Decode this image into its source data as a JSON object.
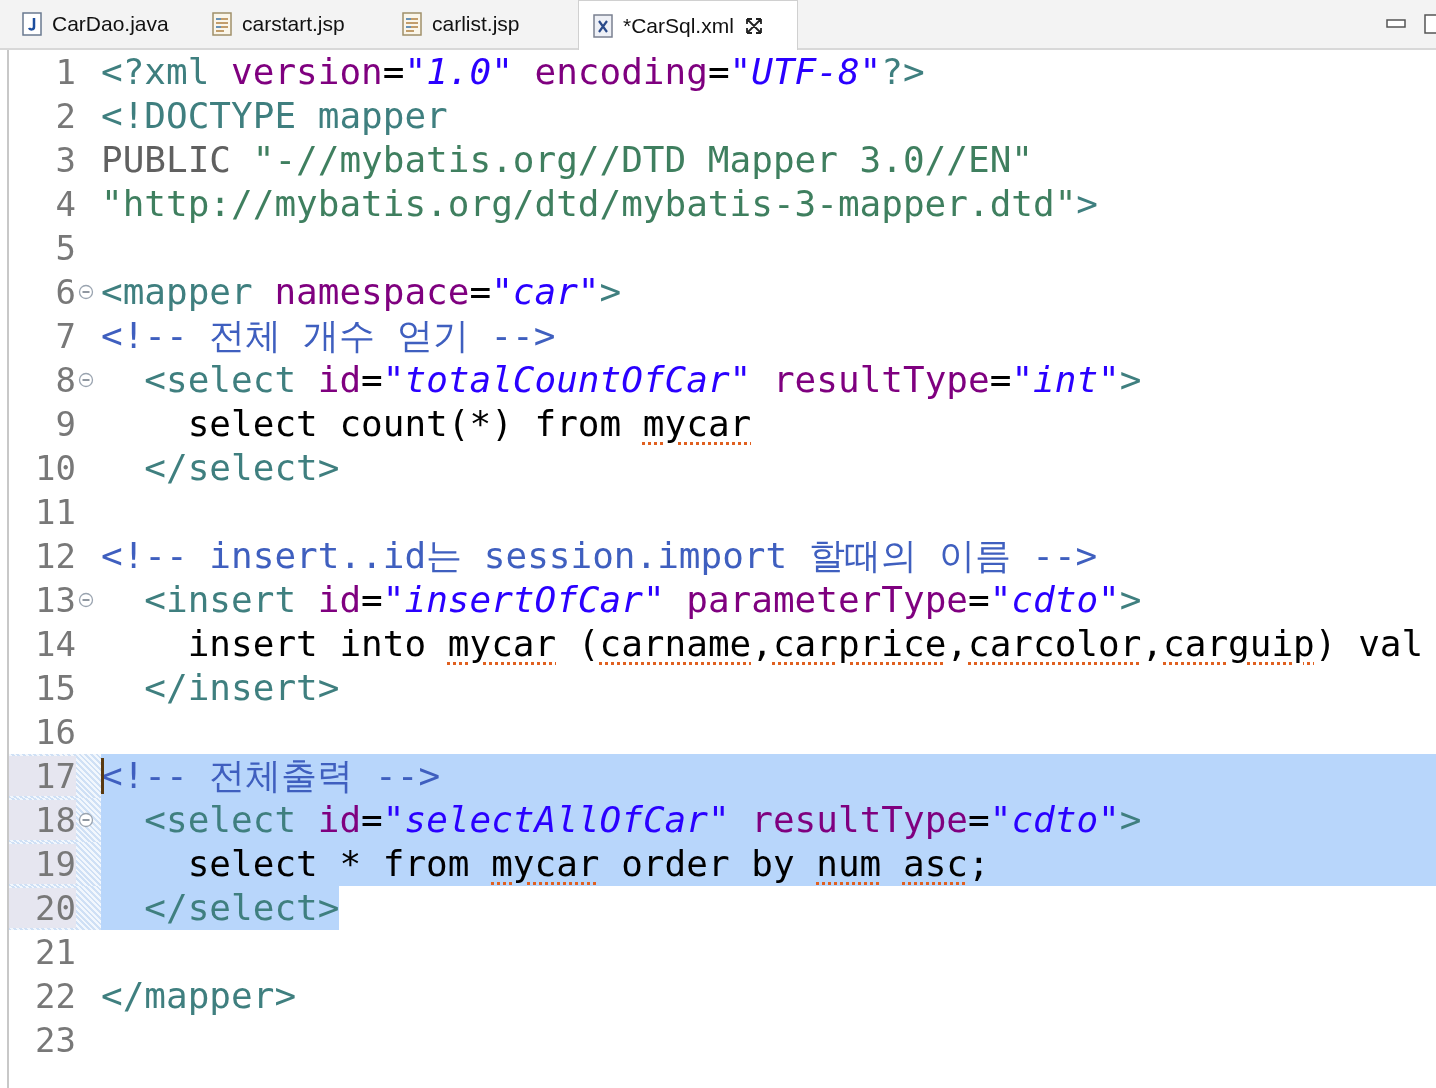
{
  "tabs": [
    {
      "label": "CarDao.java",
      "kind": "java",
      "selected": false
    },
    {
      "label": "carstart.jsp",
      "kind": "jsp",
      "selected": false
    },
    {
      "label": "carlist.jsp",
      "kind": "jsp",
      "selected": false
    },
    {
      "label": "*CarSql.xml",
      "kind": "xml",
      "selected": true
    }
  ],
  "lines": [
    {
      "number": "1",
      "selected": false,
      "tokens": [
        {
          "kind": "tag",
          "text": "<?xml "
        },
        {
          "kind": "attr",
          "text": "version"
        },
        {
          "kind": "text",
          "text": "="
        },
        {
          "kind": "str",
          "text": "\"1.0\" "
        },
        {
          "kind": "attr",
          "text": "encoding"
        },
        {
          "kind": "text",
          "text": "="
        },
        {
          "kind": "str",
          "text": "\"UTF-8\""
        },
        {
          "kind": "tag",
          "text": "?>"
        }
      ]
    },
    {
      "number": "2",
      "selected": false,
      "tokens": [
        {
          "kind": "tag",
          "text": "<!DOCTYPE mapper"
        }
      ]
    },
    {
      "number": "3",
      "selected": false,
      "tokens": [
        {
          "kind": "doc",
          "text": "PUBLIC "
        },
        {
          "kind": "docstr",
          "text": "\"-//mybatis.org//DTD Mapper 3.0//EN\""
        }
      ]
    },
    {
      "number": "4",
      "selected": false,
      "tokens": [
        {
          "kind": "docstr",
          "text": "\"http://mybatis.org/dtd/mybatis-3-mapper.dtd\""
        },
        {
          "kind": "tag",
          "text": ">"
        }
      ]
    },
    {
      "number": "5",
      "selected": false
    },
    {
      "number": "6",
      "foldable": true,
      "selected": false,
      "tokens": [
        {
          "kind": "tag",
          "text": "<mapper "
        },
        {
          "kind": "attr",
          "text": "namespace"
        },
        {
          "kind": "text",
          "text": "="
        },
        {
          "kind": "str",
          "text": "\"car\""
        },
        {
          "kind": "tag",
          "text": ">"
        }
      ]
    },
    {
      "number": "7",
      "selected": false,
      "tokens": [
        {
          "kind": "comment",
          "text": "<!-- 전체 개수 얻기 -->"
        }
      ]
    },
    {
      "number": "8",
      "foldable": true,
      "selected": false,
      "tokens": [
        {
          "kind": "tag",
          "text": "  <select "
        },
        {
          "kind": "attr",
          "text": "id"
        },
        {
          "kind": "text",
          "text": "="
        },
        {
          "kind": "str",
          "text": "\"totalCountOfCar\" "
        },
        {
          "kind": "attr",
          "text": "resultType"
        },
        {
          "kind": "text",
          "text": "="
        },
        {
          "kind": "str",
          "text": "\"int\""
        },
        {
          "kind": "tag",
          "text": ">"
        }
      ]
    },
    {
      "number": "9",
      "selected": false,
      "tokens": [
        {
          "kind": "text",
          "text": "    select count(*) from "
        },
        {
          "kind": "spell",
          "text": "mycar"
        }
      ]
    },
    {
      "number": "10",
      "selected": false,
      "tokens": [
        {
          "kind": "tag",
          "text": "  </select>"
        }
      ]
    },
    {
      "number": "11",
      "selected": false
    },
    {
      "number": "12",
      "selected": false,
      "tokens": [
        {
          "kind": "comment",
          "text": "<!-- insert..id는 session.import 할때의 이름 -->"
        }
      ]
    },
    {
      "number": "13",
      "foldable": true,
      "selected": false,
      "tokens": [
        {
          "kind": "tag",
          "text": "  <insert "
        },
        {
          "kind": "attr",
          "text": "id"
        },
        {
          "kind": "text",
          "text": "="
        },
        {
          "kind": "str",
          "text": "\"insertOfCar\" "
        },
        {
          "kind": "attr",
          "text": "parameterType"
        },
        {
          "kind": "text",
          "text": "="
        },
        {
          "kind": "str",
          "text": "\"cdto\""
        },
        {
          "kind": "tag",
          "text": ">"
        }
      ]
    },
    {
      "number": "14",
      "selected": false,
      "tokens": [
        {
          "kind": "text",
          "text": "    insert into "
        },
        {
          "kind": "spell",
          "text": "mycar"
        },
        {
          "kind": "text",
          "text": " ("
        },
        {
          "kind": "spell",
          "text": "carname"
        },
        {
          "kind": "text",
          "text": ","
        },
        {
          "kind": "spell",
          "text": "carprice"
        },
        {
          "kind": "text",
          "text": ","
        },
        {
          "kind": "spell",
          "text": "carcolor"
        },
        {
          "kind": "text",
          "text": ","
        },
        {
          "kind": "spell",
          "text": "carguip"
        },
        {
          "kind": "text",
          "text": ") val"
        }
      ]
    },
    {
      "number": "15",
      "selected": false,
      "tokens": [
        {
          "kind": "tag",
          "text": "  </insert>"
        }
      ]
    },
    {
      "number": "16",
      "selected": false
    },
    {
      "number": "17",
      "selected": true,
      "caret": true,
      "tokens": [
        {
          "kind": "comment",
          "text": "<!-- 전체출력 -->"
        }
      ]
    },
    {
      "number": "18",
      "foldable": true,
      "selected": true,
      "tokens": [
        {
          "kind": "tag",
          "text": "  <select "
        },
        {
          "kind": "attr",
          "text": "id"
        },
        {
          "kind": "text",
          "text": "="
        },
        {
          "kind": "str",
          "text": "\"selectAllOfCar\" "
        },
        {
          "kind": "attr",
          "text": "resultType"
        },
        {
          "kind": "text",
          "text": "="
        },
        {
          "kind": "str",
          "text": "\"cdto\""
        },
        {
          "kind": "tag",
          "text": ">"
        }
      ]
    },
    {
      "number": "19",
      "selected": true,
      "tokens": [
        {
          "kind": "text",
          "text": "    select * from "
        },
        {
          "kind": "spell",
          "text": "mycar"
        },
        {
          "kind": "text",
          "text": " order by "
        },
        {
          "kind": "spell",
          "text": "num asc"
        },
        {
          "kind": "text",
          "text": ";"
        }
      ]
    },
    {
      "number": "20",
      "selected": true,
      "tokens": [
        {
          "kind": "tag",
          "text": "  </select>"
        }
      ]
    },
    {
      "number": "21",
      "selected": false
    },
    {
      "number": "22",
      "selected": false,
      "tokens": [
        {
          "kind": "tag",
          "text": "</mapper>"
        }
      ]
    },
    {
      "number": "23",
      "selected": false
    }
  ]
}
